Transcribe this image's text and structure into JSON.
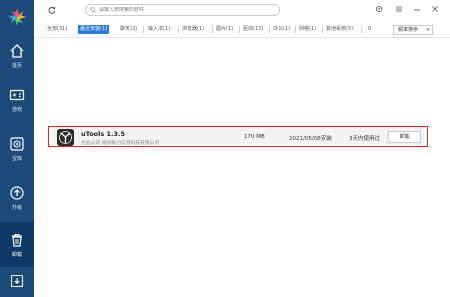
{
  "sidebar": {
    "items": [
      {
        "label": "首页",
        "icon": "home-icon"
      },
      {
        "label": "游戏",
        "icon": "gamepad-icon"
      },
      {
        "label": "宝库",
        "icon": "vault-icon"
      },
      {
        "label": "升级",
        "icon": "upgrade-icon"
      },
      {
        "label": "卸载",
        "icon": "trash-icon"
      },
      {
        "label": "",
        "icon": "download-icon"
      }
    ],
    "active_index": 4
  },
  "search": {
    "placeholder": "请输入想搜索的软件"
  },
  "filters": [
    {
      "label": "全部(31)"
    },
    {
      "label": "最近安装(1)"
    },
    {
      "label": "聊天(2)"
    },
    {
      "label": "输入法(1)"
    },
    {
      "label": "浏览器(1)"
    },
    {
      "label": "图片(1)"
    },
    {
      "label": "驱动(13)"
    },
    {
      "label": "办公(1)"
    },
    {
      "label": "网络(1)"
    },
    {
      "label": "其他系统(5)"
    },
    {
      "label": "0"
    }
  ],
  "active_filter_index": 1,
  "sort": {
    "label": "频率排序",
    "caret": "▾"
  },
  "app": {
    "name": "uTools 1.3.5",
    "publisher": "出品公司  福州猿力信息科技有限公司",
    "size": "170 MB",
    "date": "2021/05/06安装",
    "used": "3天内使用过",
    "uninstall_label": "卸载"
  },
  "colors": {
    "sidebar": "#1c4a7a",
    "sidebar_active": "#0f3a67",
    "accent": "#2a7bd6",
    "highlight_border": "#e0271f"
  }
}
